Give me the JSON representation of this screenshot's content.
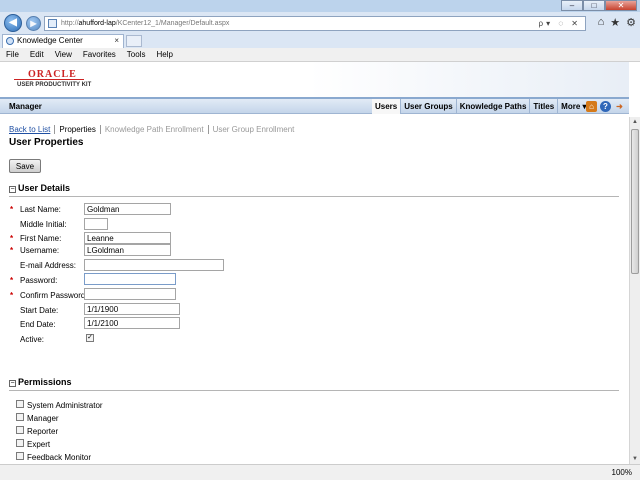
{
  "browser": {
    "window_buttons": [
      "–",
      "□",
      "✕"
    ],
    "back_glyph": "◀",
    "forward_glyph": "▶",
    "address": {
      "prefix": "http://",
      "host": "ahufford-lap",
      "path": "/KCenter12_1/Manager/Default.aspx",
      "tools": "ρ▾ ◌ ✕"
    },
    "nav_icons": [
      "⌂",
      "★",
      "⚙"
    ],
    "tab": {
      "title": "Knowledge Center",
      "close": "×"
    },
    "menu": [
      "File",
      "Edit",
      "View",
      "Favorites",
      "Tools",
      "Help"
    ],
    "zoom": "100%"
  },
  "brand": {
    "name": "ORACLE",
    "product": "USER PRODUCTIVITY KIT",
    "color": "#cc2222"
  },
  "header": {
    "title": "Manager",
    "nav": [
      "Users",
      "User Groups",
      "Knowledge Paths",
      "Titles",
      "More ▾"
    ],
    "active_nav": "Users",
    "icons": {
      "home": "⌂",
      "help": "?",
      "logout": "➜"
    }
  },
  "breadcrumbs": {
    "back": "Back to List",
    "properties": "Properties",
    "kp_enrollment": "Knowledge Path Enrollment",
    "ug_enrollment": "User Group Enrollment"
  },
  "page_title": "User Properties",
  "save_label": "Save",
  "details": {
    "heading": "User Details",
    "toggle": "−",
    "required_mark": "*",
    "fields": {
      "last_name": {
        "label": "Last Name:",
        "value": "Goldman"
      },
      "middle_initial": {
        "label": "Middle Initial:",
        "value": ""
      },
      "first_name": {
        "label": "First Name:",
        "value": "Leanne"
      },
      "username": {
        "label": "Username:",
        "value": "LGoldman"
      },
      "email": {
        "label": "E-mail Address:",
        "value": ""
      },
      "password": {
        "label": "Password:",
        "value": ""
      },
      "confirm_password": {
        "label": "Confirm Password:",
        "value": ""
      },
      "start_date": {
        "label": "Start Date:",
        "value": "1/1/1900"
      },
      "end_date": {
        "label": "End Date:",
        "value": "1/1/2100"
      },
      "active": {
        "label": "Active:",
        "checked": true,
        "mark": "✓"
      }
    }
  },
  "permissions": {
    "heading": "Permissions",
    "toggle": "−",
    "items": [
      {
        "label": "System Administrator",
        "checked": false
      },
      {
        "label": "Manager",
        "checked": false
      },
      {
        "label": "Reporter",
        "checked": false
      },
      {
        "label": "Expert",
        "checked": false
      },
      {
        "label": "Feedback Monitor",
        "checked": false
      }
    ]
  }
}
